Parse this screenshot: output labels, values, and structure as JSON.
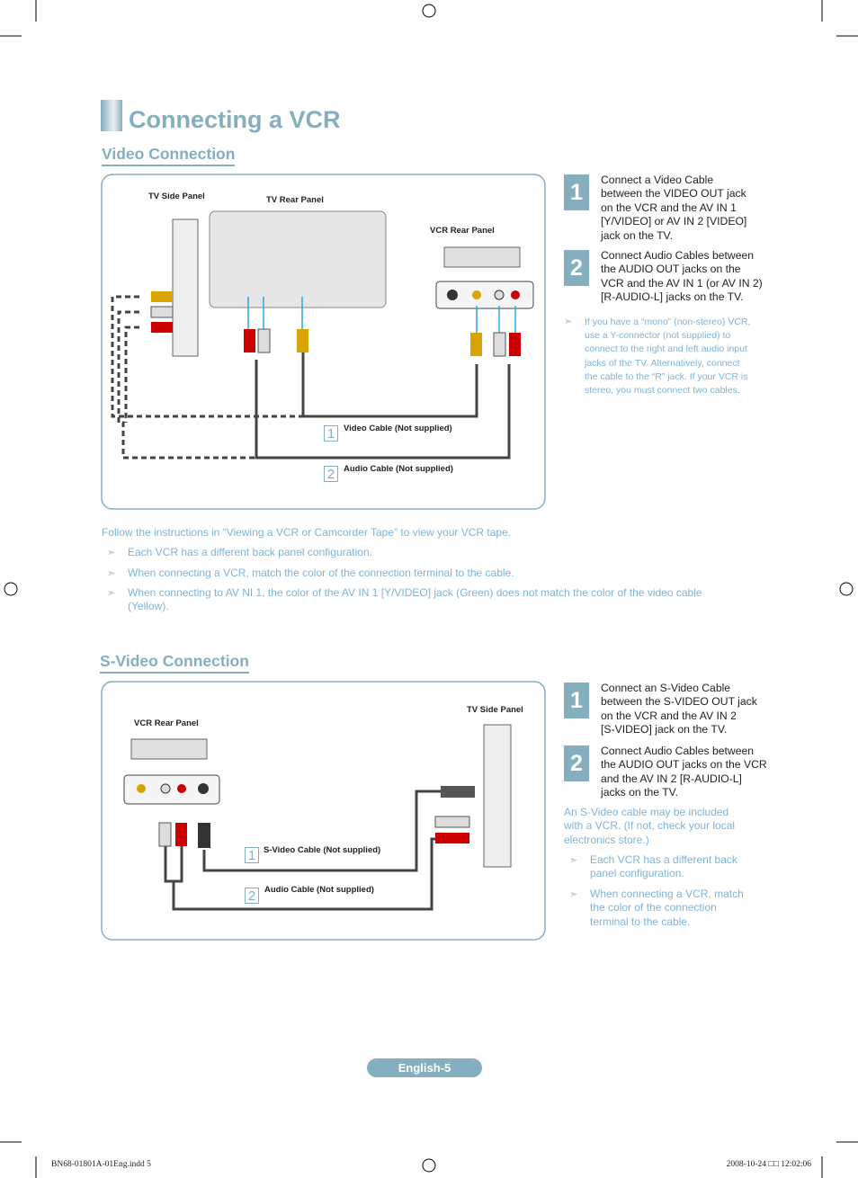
{
  "title": "Connecting a VCR",
  "video": {
    "section": "Video Connection",
    "labels": {
      "tv_side": "TV Side Panel",
      "tv_rear": "TV Rear Panel",
      "vcr_rear": "VCR Rear Panel"
    },
    "cables": [
      {
        "num": "1",
        "label": "Video Cable (Not supplied)"
      },
      {
        "num": "2",
        "label": "Audio Cable (Not supplied)"
      }
    ],
    "steps": [
      {
        "num": "1",
        "lines": [
          "Connect a Video Cable",
          "between the VIDEO OUT jack",
          "on the VCR and the AV IN 1",
          "[Y/VIDEO] or AV IN 2 [VIDEO]",
          "jack on the TV."
        ]
      },
      {
        "num": "2",
        "lines": [
          "Connect Audio Cables between",
          "the AUDIO OUT jacks on the",
          "VCR and the AV IN 1 (or AV IN 2)",
          "[R-AUDIO-L] jacks on the TV."
        ]
      }
    ],
    "side_note": [
      "If you have a “mono” (non-stereo) VCR,",
      "use a Y-connector (not supplied) to",
      "connect to the right and left audio input",
      "jacks of the TV. Alternatively, connect",
      "the cable to the “R” jack. If your VCR is",
      "stereo, you must connect two cables."
    ],
    "follow": "Follow the instructions in “Viewing a VCR or Camcorder Tape” to view your VCR tape.",
    "notes": [
      "Each VCR has a different back panel configuration.",
      "When connecting a VCR, match the color of the connection terminal to the cable.",
      "When connecting to AV NI 1, the color of the AV IN 1 [Y/VIDEO] jack (Green) does not match the color of the video cable",
      "(Yellow)."
    ]
  },
  "svideo": {
    "section": "S-Video Connection",
    "labels": {
      "vcr_rear": "VCR Rear Panel",
      "tv_side": "TV Side Panel"
    },
    "cables": [
      {
        "num": "1",
        "label": "S-Video Cable (Not supplied)"
      },
      {
        "num": "2",
        "label": "Audio Cable (Not supplied)"
      }
    ],
    "steps": [
      {
        "num": "1",
        "lines": [
          "Connect an S-Video Cable",
          "between the S-VIDEO OUT jack",
          "on the VCR and the AV IN 2",
          "[S-VIDEO] jack on the TV."
        ]
      },
      {
        "num": "2",
        "lines": [
          "Connect Audio Cables between",
          "the AUDIO OUT jacks on the VCR",
          "and the AV IN 2 [R-AUDIO-L]",
          "jacks on the TV."
        ]
      }
    ],
    "side_note": [
      "An S-Video cable may be included",
      "with a VCR. (If not, check your local",
      "electronics store.)"
    ],
    "notes": [
      [
        "Each VCR has a different back",
        "panel configuration."
      ],
      [
        "When connecting a VCR, match",
        "the color of the connection",
        "terminal to the cable."
      ]
    ]
  },
  "page_label": "English-5",
  "footer": {
    "left": "BN68-01801A-01Eng.indd   5",
    "right": "2008-10-24   □□ 12:02:06"
  },
  "colors": {
    "accent": "#85aebf",
    "note": "#7fb3d8"
  }
}
